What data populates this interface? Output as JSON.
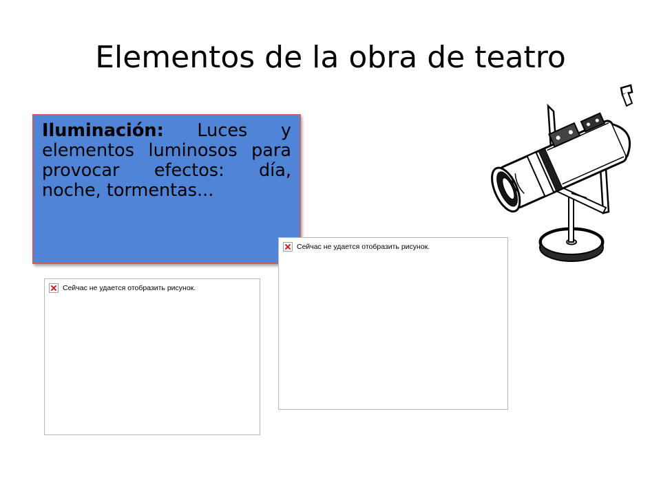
{
  "slide": {
    "title": "Elementos de la obra de teatro",
    "textbox": {
      "heading": "Iluminación:",
      "body": " Luces y elementos luminosos para provocar efectos: día, noche, tormentas..."
    },
    "placeholders": [
      {
        "message": "Сейчас не удается отобразить рисунок.",
        "icon": "broken-image-icon"
      },
      {
        "message": "Сейчас не удается отобразить рисунок.",
        "icon": "broken-image-icon"
      }
    ],
    "illustration": {
      "icon": "spotlight-icon"
    },
    "colors": {
      "textbox_fill": "#4f84d6",
      "textbox_border": "#c9615f",
      "error_x": "#cc2222"
    }
  }
}
